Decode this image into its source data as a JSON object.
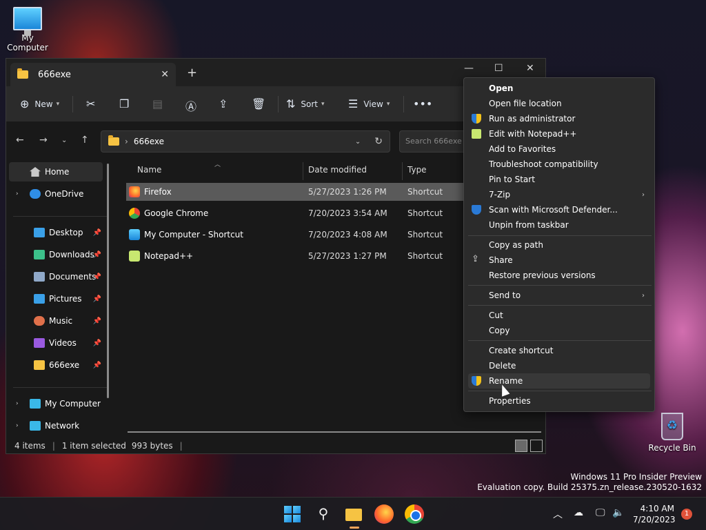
{
  "desktop": {
    "my_computer_label": "My Computer",
    "recycle_bin_label": "Recycle Bin",
    "watermark_line1": "Windows 11 Pro Insider Preview",
    "watermark_line2": "Evaluation copy. Build 25375.zn_release.230520-1632"
  },
  "window": {
    "tab_title": "666exe",
    "tab_close": "✕",
    "new_tab": "+",
    "minimize": "—",
    "maximize": "☐",
    "close": "✕"
  },
  "toolbar": {
    "new_label": "New",
    "sort_label": "Sort",
    "view_label": "View",
    "more": "•••"
  },
  "address": {
    "path": "666exe",
    "search_placeholder": "Search 666exe"
  },
  "nav": {
    "home": "Home",
    "onedrive": "OneDrive",
    "quick_access": [
      {
        "label": "Desktop"
      },
      {
        "label": "Downloads"
      },
      {
        "label": "Documents"
      },
      {
        "label": "Pictures"
      },
      {
        "label": "Music"
      },
      {
        "label": "Videos"
      },
      {
        "label": "666exe"
      }
    ],
    "my_computer": "My Computer",
    "network": "Network"
  },
  "filelist": {
    "columns": {
      "name": "Name",
      "date": "Date modified",
      "type": "Type"
    },
    "rows": [
      {
        "name": "Firefox",
        "date": "5/27/2023 1:26 PM",
        "type": "Shortcut"
      },
      {
        "name": "Google Chrome",
        "date": "7/20/2023 3:54 AM",
        "type": "Shortcut"
      },
      {
        "name": "My Computer - Shortcut",
        "date": "7/20/2023 4:08 AM",
        "type": "Shortcut"
      },
      {
        "name": "Notepad++",
        "date": "5/27/2023 1:27 PM",
        "type": "Shortcut"
      }
    ]
  },
  "status": {
    "count": "4 items",
    "selected": "1 item selected",
    "size": "993 bytes"
  },
  "context_menu": {
    "open": "Open",
    "open_file_location": "Open file location",
    "run_as_admin": "Run as administrator",
    "edit_notepad": "Edit with Notepad++",
    "add_favorites": "Add to Favorites",
    "troubleshoot": "Troubleshoot compatibility",
    "pin_start": "Pin to Start",
    "seven_zip": "7-Zip",
    "scan_defender": "Scan with Microsoft Defender...",
    "unpin_taskbar": "Unpin from taskbar",
    "copy_path": "Copy as path",
    "share": "Share",
    "restore": "Restore previous versions",
    "send_to": "Send to",
    "cut": "Cut",
    "copy": "Copy",
    "create_shortcut": "Create shortcut",
    "delete": "Delete",
    "rename": "Rename",
    "properties": "Properties"
  },
  "taskbar": {
    "time": "4:10 AM",
    "date": "7/20/2023",
    "notification_count": "1"
  }
}
